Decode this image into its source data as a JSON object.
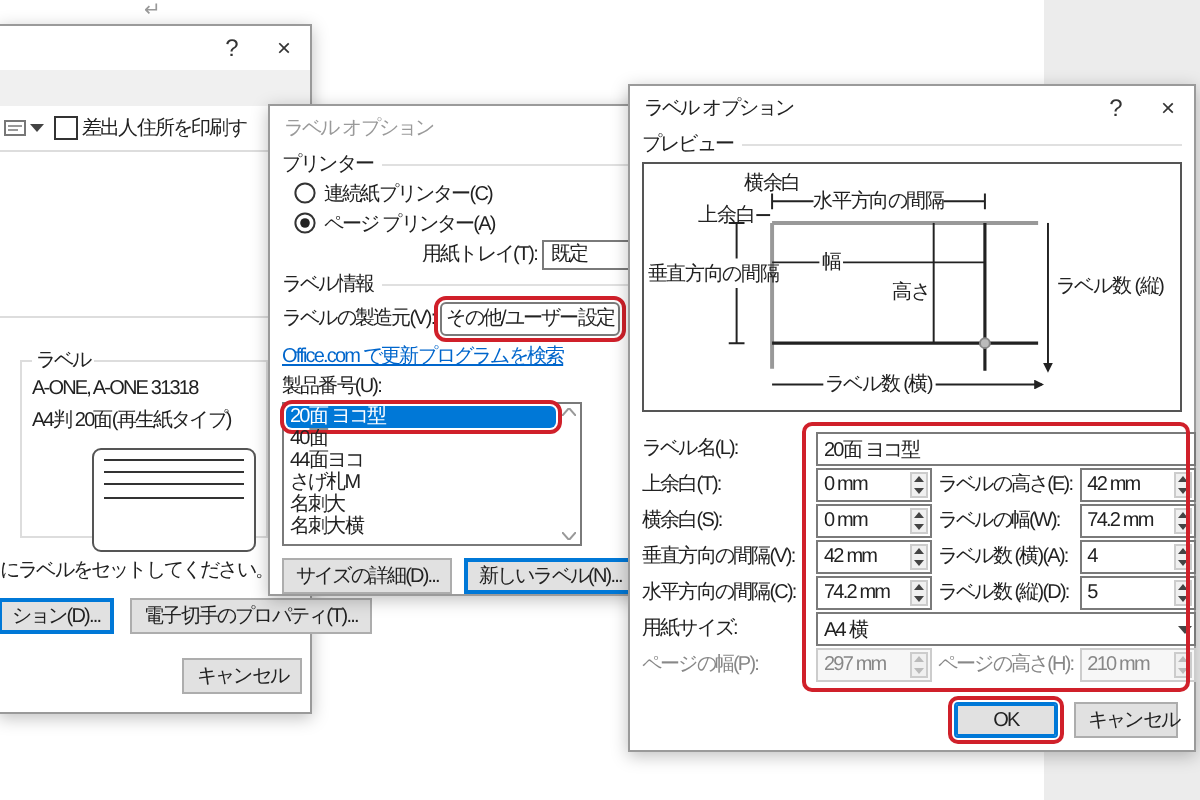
{
  "document": {
    "paragraph_mark": "↵"
  },
  "envelope_dialog": {
    "help": "?",
    "close": "×",
    "return_address": {
      "label": "差出人住所を印刷す",
      "checked": false
    },
    "label_group": {
      "title": "ラベル",
      "lines": [
        "A-ONE, A-ONE 31318",
        "A4判 20面(再生紙タイプ)"
      ]
    },
    "instruction": "にラベルをセットしてください。",
    "buttons": [
      {
        "label": "ション(D)...",
        "focused": true
      },
      {
        "label": "電子切手のプロパティ(T)...",
        "focused": false
      }
    ],
    "cancel": "キャンセル"
  },
  "label_options_back": {
    "title": "ラベル オプション",
    "printer_heading": "プリンター",
    "printer_types": [
      {
        "label": "連続紙プリンター(C)",
        "selected": false
      },
      {
        "label": "ページ プリンター(A)",
        "selected": true
      }
    ],
    "tray_label": "用紙トレイ(T):",
    "tray_value": "既定",
    "info_heading": "ラベル情報",
    "vendor_label": "ラベルの製造元(V):",
    "vendor_value": "その他/ユーザー設定",
    "vendor_highlighted": true,
    "update_link": "Office.com で更新プログラムを検索",
    "product_label": "製品番号(U):",
    "products": [
      {
        "name": "20面 ヨコ型",
        "selected": true,
        "highlighted": true
      },
      {
        "name": "40面",
        "selected": false,
        "highlighted": false
      },
      {
        "name": "44面ヨコ",
        "selected": false,
        "highlighted": false
      },
      {
        "name": "さげ札M",
        "selected": false,
        "highlighted": false
      },
      {
        "name": "名刺大",
        "selected": false,
        "highlighted": false
      },
      {
        "name": "名刺大横",
        "selected": false,
        "highlighted": false
      }
    ],
    "buttons": [
      {
        "label": "サイズの詳細(D)...",
        "focused": false
      },
      {
        "label": "新しいラベル(N)...",
        "focused": true
      }
    ]
  },
  "label_options": {
    "title": "ラベル オプション",
    "help": "?",
    "close": "×",
    "preview_heading": "プレビュー",
    "diagram": {
      "side_margin": "横余白",
      "top_margin": "上余白",
      "horizontal_pitch": "水平方向の間隔",
      "width": "幅",
      "vertical_pitch": "垂直方向の間隔",
      "height": "高さ",
      "rows": "ラベル数 (縦)",
      "columns": "ラベル数 (横)"
    },
    "form_highlighted": true,
    "rows": [
      {
        "kind": "text",
        "label": "ラベル名(L):",
        "value": "20面 ヨコ型"
      },
      {
        "kind": "pair",
        "fields": [
          {
            "label": "上余白(T):",
            "value": "0 mm",
            "disabled": false
          },
          {
            "label": "ラベルの高さ(E):",
            "value": "42 mm",
            "disabled": false
          }
        ]
      },
      {
        "kind": "pair",
        "fields": [
          {
            "label": "横余白(S):",
            "value": "0 mm",
            "disabled": false
          },
          {
            "label": "ラベルの幅(W):",
            "value": "74.2 mm",
            "disabled": false
          }
        ]
      },
      {
        "kind": "pair",
        "fields": [
          {
            "label": "垂直方向の間隔(V):",
            "value": "42 mm",
            "disabled": false
          },
          {
            "label": "ラベル数 (横)(A):",
            "value": "4",
            "disabled": false
          }
        ]
      },
      {
        "kind": "pair",
        "fields": [
          {
            "label": "水平方向の間隔(C):",
            "value": "74.2 mm",
            "disabled": false
          },
          {
            "label": "ラベル数 (縦)(D):",
            "value": "5",
            "disabled": false
          }
        ]
      },
      {
        "kind": "dropdown",
        "label": "用紙サイズ:",
        "value": "A4 横"
      },
      {
        "kind": "pair",
        "fields": [
          {
            "label": "ページの幅(P):",
            "value": "297 mm",
            "disabled": true
          },
          {
            "label": "ページの高さ(H):",
            "value": "210 mm",
            "disabled": true
          }
        ]
      }
    ],
    "buttons": [
      {
        "label": "OK",
        "default": true,
        "highlighted": true
      },
      {
        "label": "キャンセル",
        "default": false,
        "highlighted": false
      }
    ]
  }
}
